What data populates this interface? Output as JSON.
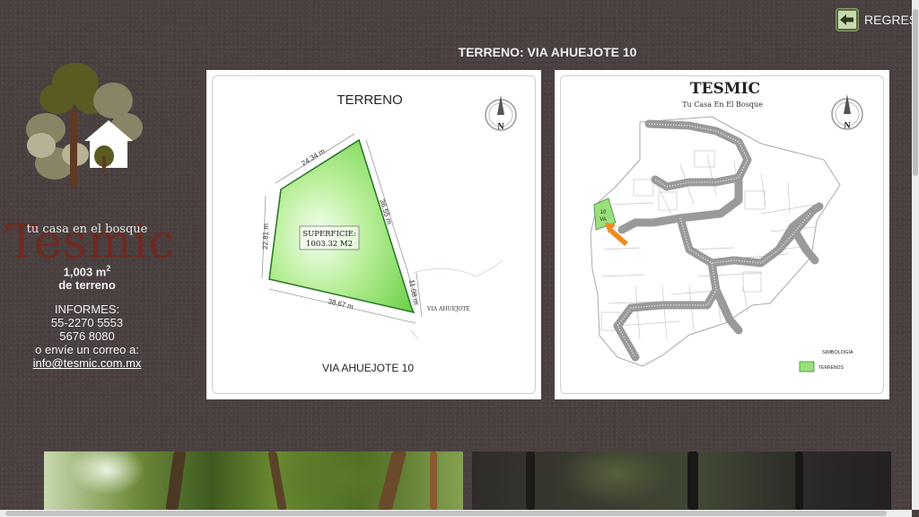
{
  "nav": {
    "back_label": "REGRESAR",
    "back_icon": "arrow-left-icon"
  },
  "page": {
    "title": "TERRENO: VIA AHUEJOTE 10"
  },
  "logo": {
    "wordmark": "Tesmic",
    "tagline": "tu casa en el bosque"
  },
  "sidebar": {
    "area_value": "1,003 m",
    "area_unit_sup": "2",
    "area_caption": "de terreno",
    "informes_label": "INFORMES:",
    "phone_1": "55-2270 5553",
    "phone_2": "5676 8080",
    "email_prompt": "o envíe un correo a:",
    "email": "info@tesmic.com.mx"
  },
  "plot_map": {
    "heading": "TERRENO",
    "compass_letter": "N",
    "side_top": "24.34 m",
    "side_right": "36.55 m",
    "side_left": "22.81 m",
    "side_bottom": "38.67 m",
    "side_street": "11.08 m",
    "surface_label": "SUPERFICIE:",
    "surface_value": "1003.32 M2",
    "street_label": "VIA AHUEJOTE",
    "footer": "VIA AHUEJOTE 10",
    "fill_color": "#9be07a"
  },
  "site_map": {
    "heading": "TESMIC",
    "subheading": "Tu Casa En El Bosque",
    "compass_letter": "N",
    "lot_label_line1": "10",
    "lot_label_line2": "VA",
    "legend_title": "SIMBOLOGÍA",
    "legend_item": "TERRENOS",
    "road_color": "#9a9a9a",
    "highlight_color": "#9be07a",
    "pointer_color": "#f08a20"
  }
}
